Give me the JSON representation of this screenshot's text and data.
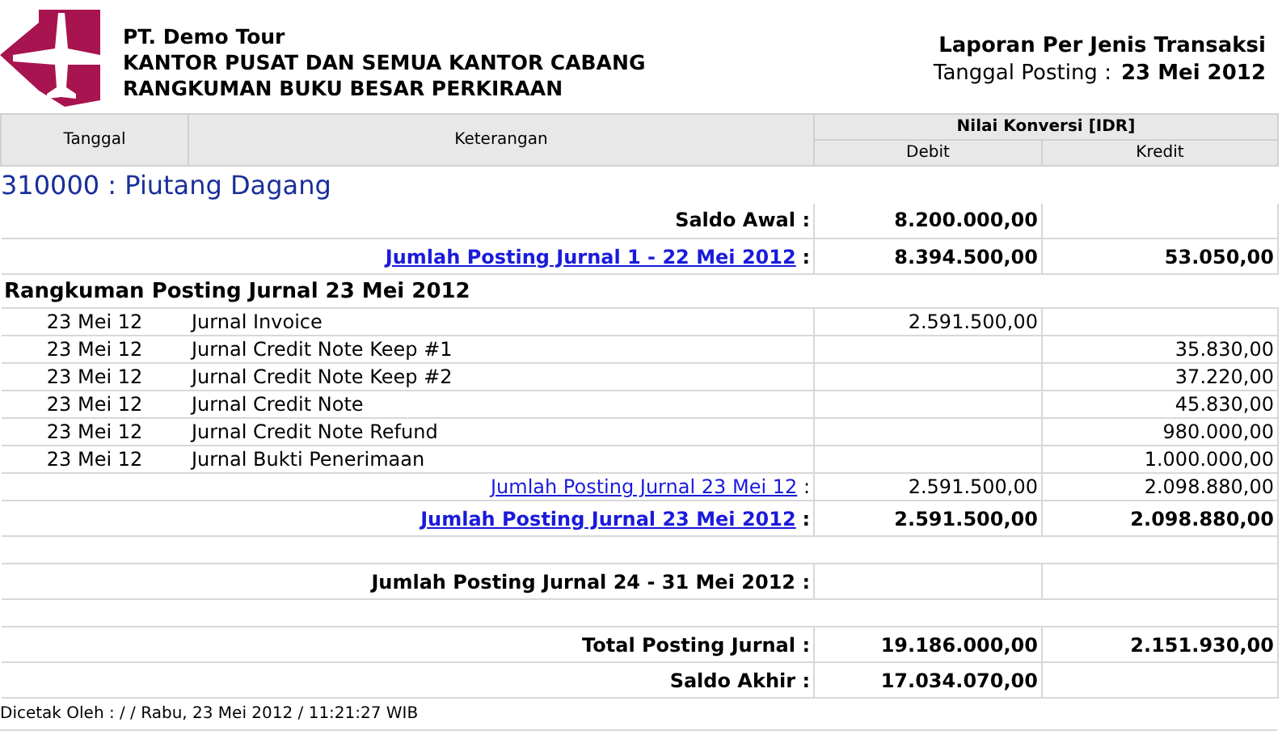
{
  "header": {
    "company": "PT. Demo Tour",
    "office": "KANTOR PUSAT DAN SEMUA KANTOR CABANG",
    "report": "RANGKUMAN BUKU BESAR PERKIRAAN",
    "report_type": "Laporan Per Jenis Transaksi",
    "date_label": "Tanggal Posting :",
    "date_value": "23 Mei 2012"
  },
  "table": {
    "columns": {
      "tanggal": "Tanggal",
      "keterangan": "Keterangan",
      "group": "Nilai Konversi [IDR]",
      "debit": "Debit",
      "kredit": "Kredit"
    },
    "account": "310000 : Piutang Dagang",
    "rows": [
      {
        "kind": "summary",
        "label": "Saldo Awal :",
        "bold": true,
        "debit": "8.200.000,00"
      },
      {
        "kind": "summary",
        "link": "Jumlah Posting Jurnal 1 - 22 Mei 2012",
        "suffix": ":",
        "bold": true,
        "debit": "8.394.500,00",
        "kredit": "53.050,00"
      },
      {
        "kind": "heading",
        "label": "Rangkuman Posting Jurnal 23 Mei 2012"
      },
      {
        "kind": "detail",
        "date": "23 Mei 12",
        "label": "Jurnal Invoice",
        "debit": "2.591.500,00"
      },
      {
        "kind": "detail",
        "date": "23 Mei 12",
        "label": "Jurnal Credit Note Keep #1",
        "kredit": "35.830,00"
      },
      {
        "kind": "detail",
        "date": "23 Mei 12",
        "label": "Jurnal Credit Note Keep #2",
        "kredit": "37.220,00"
      },
      {
        "kind": "detail",
        "date": "23 Mei 12",
        "label": "Jurnal Credit Note",
        "kredit": "45.830,00"
      },
      {
        "kind": "detail",
        "date": "23 Mei 12",
        "label": "Jurnal Credit Note Refund",
        "kredit": "980.000,00"
      },
      {
        "kind": "detail",
        "date": "23 Mei 12",
        "label": "Jurnal Bukti Penerimaan",
        "kredit": "1.000.000,00"
      },
      {
        "kind": "summary",
        "link": "Jumlah Posting Jurnal 23 Mei 12",
        "suffix": ":",
        "bold": false,
        "debit": "2.591.500,00",
        "kredit": "2.098.880,00"
      },
      {
        "kind": "summary",
        "link": "Jumlah Posting Jurnal 23 Mei 2012",
        "suffix": ":",
        "bold": true,
        "debit": "2.591.500,00",
        "kredit": "2.098.880,00"
      },
      {
        "kind": "blank"
      },
      {
        "kind": "summary",
        "label": "Jumlah Posting Jurnal 24 - 31 Mei 2012 :",
        "bold": true
      },
      {
        "kind": "blank"
      },
      {
        "kind": "summary",
        "label": "Total Posting Jurnal :",
        "bold": true,
        "debit": "19.186.000,00",
        "kredit": "2.151.930,00"
      },
      {
        "kind": "summary",
        "label": "Saldo Akhir :",
        "bold": true,
        "debit": "17.034.070,00"
      }
    ]
  },
  "footer": "Dicetak Oleh : / / Rabu, 23 Mei 2012 / 11:21:27 WIB"
}
